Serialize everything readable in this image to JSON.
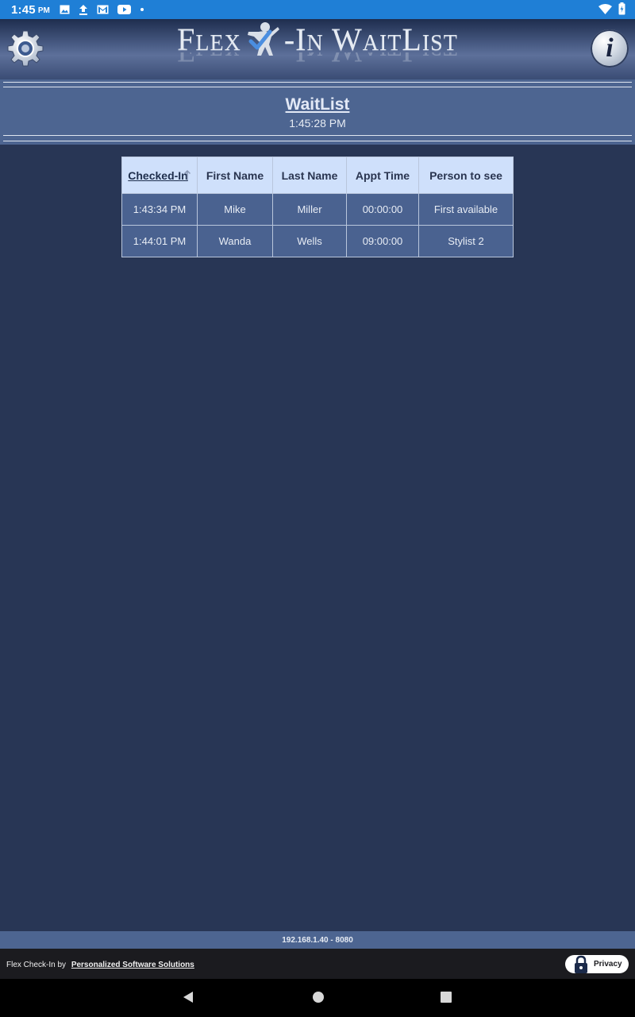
{
  "status_bar": {
    "time": "1:45",
    "ampm": "PM",
    "left_icons": [
      "image-icon",
      "upload-icon",
      "gmail-icon",
      "youtube-icon",
      "dot-icon"
    ],
    "right_icons": [
      "wifi-icon",
      "battery-icon"
    ]
  },
  "header": {
    "logo_text_left": "Flex",
    "logo_text_right": "-In WaitList",
    "settings_icon": "gear-icon",
    "info_label": "i"
  },
  "page": {
    "title": "WaitList",
    "time": "1:45:28 PM"
  },
  "table": {
    "columns": [
      "Checked-In",
      "First Name",
      "Last Name",
      "Appt Time",
      "Person to see"
    ],
    "sort_column": "Checked-In",
    "rows": [
      [
        "1:43:34 PM",
        "Mike",
        "Miller",
        "00:00:00",
        "First available"
      ],
      [
        "1:44:01 PM",
        "Wanda",
        "Wells",
        "09:00:00",
        "Stylist 2"
      ]
    ]
  },
  "server_bar": {
    "address": "192.168.1.40 - 8080"
  },
  "footer": {
    "prefix": "Flex Check-In by",
    "company": "Personalized Software Solutions",
    "privacy_label": "Privacy"
  },
  "colors": {
    "status_bar": "#1f7fd6",
    "background": "#283655",
    "band": "#4d6591",
    "table_header": "#cfe0fb",
    "table_row": "#4a6290"
  }
}
